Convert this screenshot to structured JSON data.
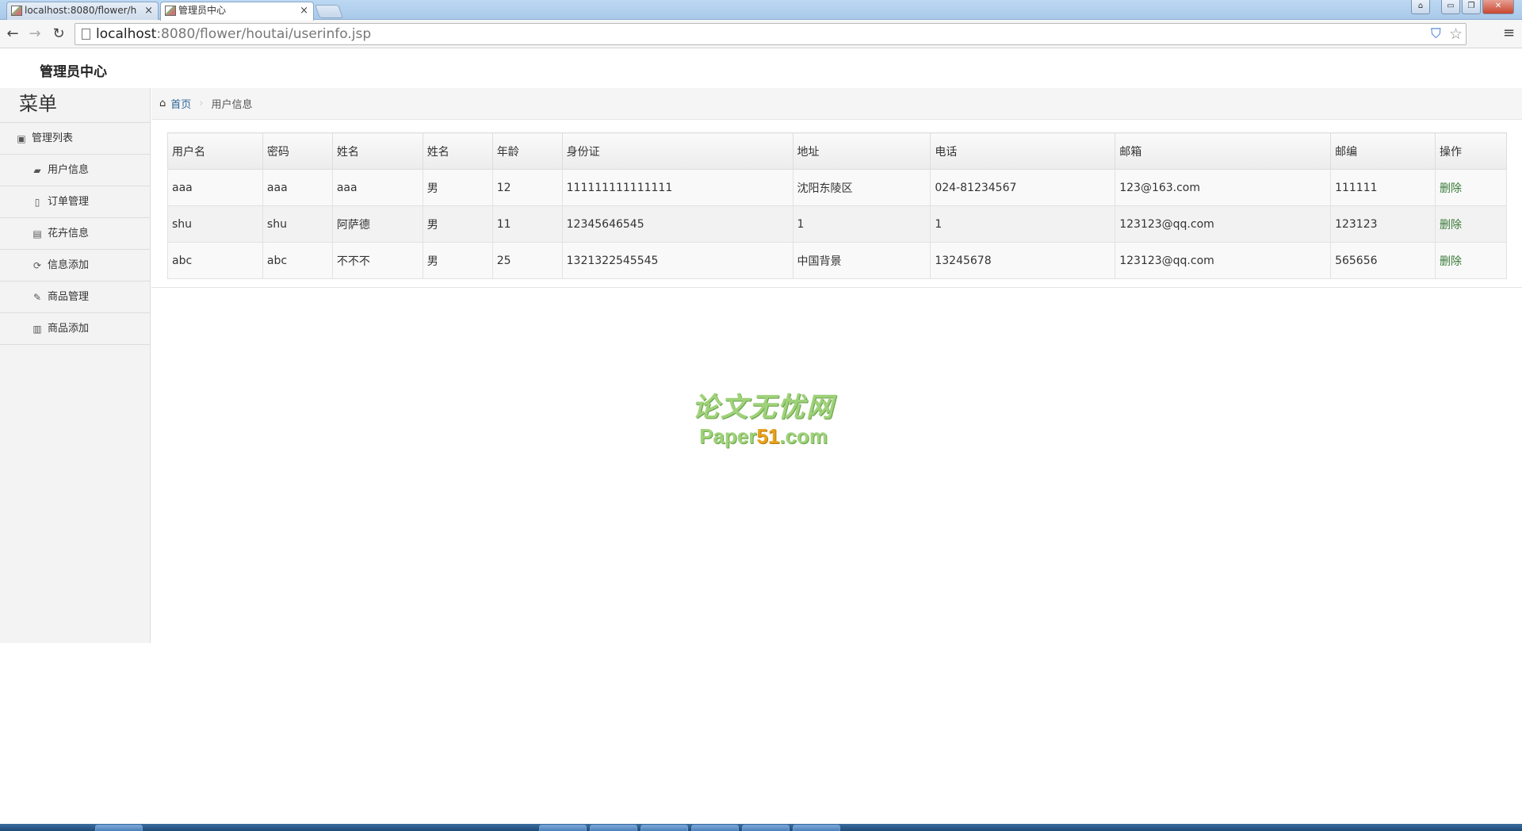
{
  "browser": {
    "tabs": [
      {
        "title": "localhost:8080/flower/h",
        "close": "×"
      },
      {
        "title": "管理员中心",
        "close": "×"
      }
    ],
    "window_title": "",
    "window_buttons": {
      "user": "⌂",
      "minimize": "▭",
      "restore": "❐",
      "close": "✕"
    },
    "nav": {
      "back": "←",
      "forward": "→",
      "reload": "↻"
    },
    "url_host": "localhost",
    "url_rest": ":8080/flower/houtai/userinfo.jsp",
    "menu": "≡"
  },
  "header": {
    "brand": "管理员中心"
  },
  "sidebar": {
    "title": "菜单",
    "section": {
      "label": "管理列表",
      "icon": "list-icon"
    },
    "items": [
      {
        "label": "用户信息",
        "icon": "users-icon",
        "glyph": "▰"
      },
      {
        "label": "订单管理",
        "icon": "file-icon",
        "glyph": "▯"
      },
      {
        "label": "花卉信息",
        "icon": "document-icon",
        "glyph": "▤"
      },
      {
        "label": "信息添加",
        "icon": "refresh-icon",
        "glyph": "⟳"
      },
      {
        "label": "商品管理",
        "icon": "wrench-icon",
        "glyph": "✎"
      },
      {
        "label": "商品添加",
        "icon": "trash-icon",
        "glyph": "▥"
      }
    ]
  },
  "breadcrumb": {
    "home": "首页",
    "current": "用户信息"
  },
  "table": {
    "headers": [
      "用户名",
      "密码",
      "姓名",
      "姓名",
      "年龄",
      "身份证",
      "地址",
      "电话",
      "邮箱",
      "邮编",
      "操作"
    ],
    "rows": [
      [
        "aaa",
        "aaa",
        "aaa",
        "男",
        "12",
        "111111111111111",
        "沈阳东陵区",
        "024-81234567",
        "123@163.com",
        "111111",
        "删除"
      ],
      [
        "shu",
        "shu",
        "阿萨德",
        "男",
        "11",
        "12345646545",
        "1",
        "1",
        "123123@qq.com",
        "123123",
        "删除"
      ],
      [
        "abc",
        "abc",
        "不不不",
        "男",
        "25",
        "1321322545545",
        "中国背景",
        "13245678",
        "123123@qq.com",
        "565656",
        "删除"
      ]
    ]
  },
  "watermark": {
    "cn": "论文无忧网",
    "en_a": "Paper",
    "en_b": "51",
    "en_c": ".com"
  }
}
